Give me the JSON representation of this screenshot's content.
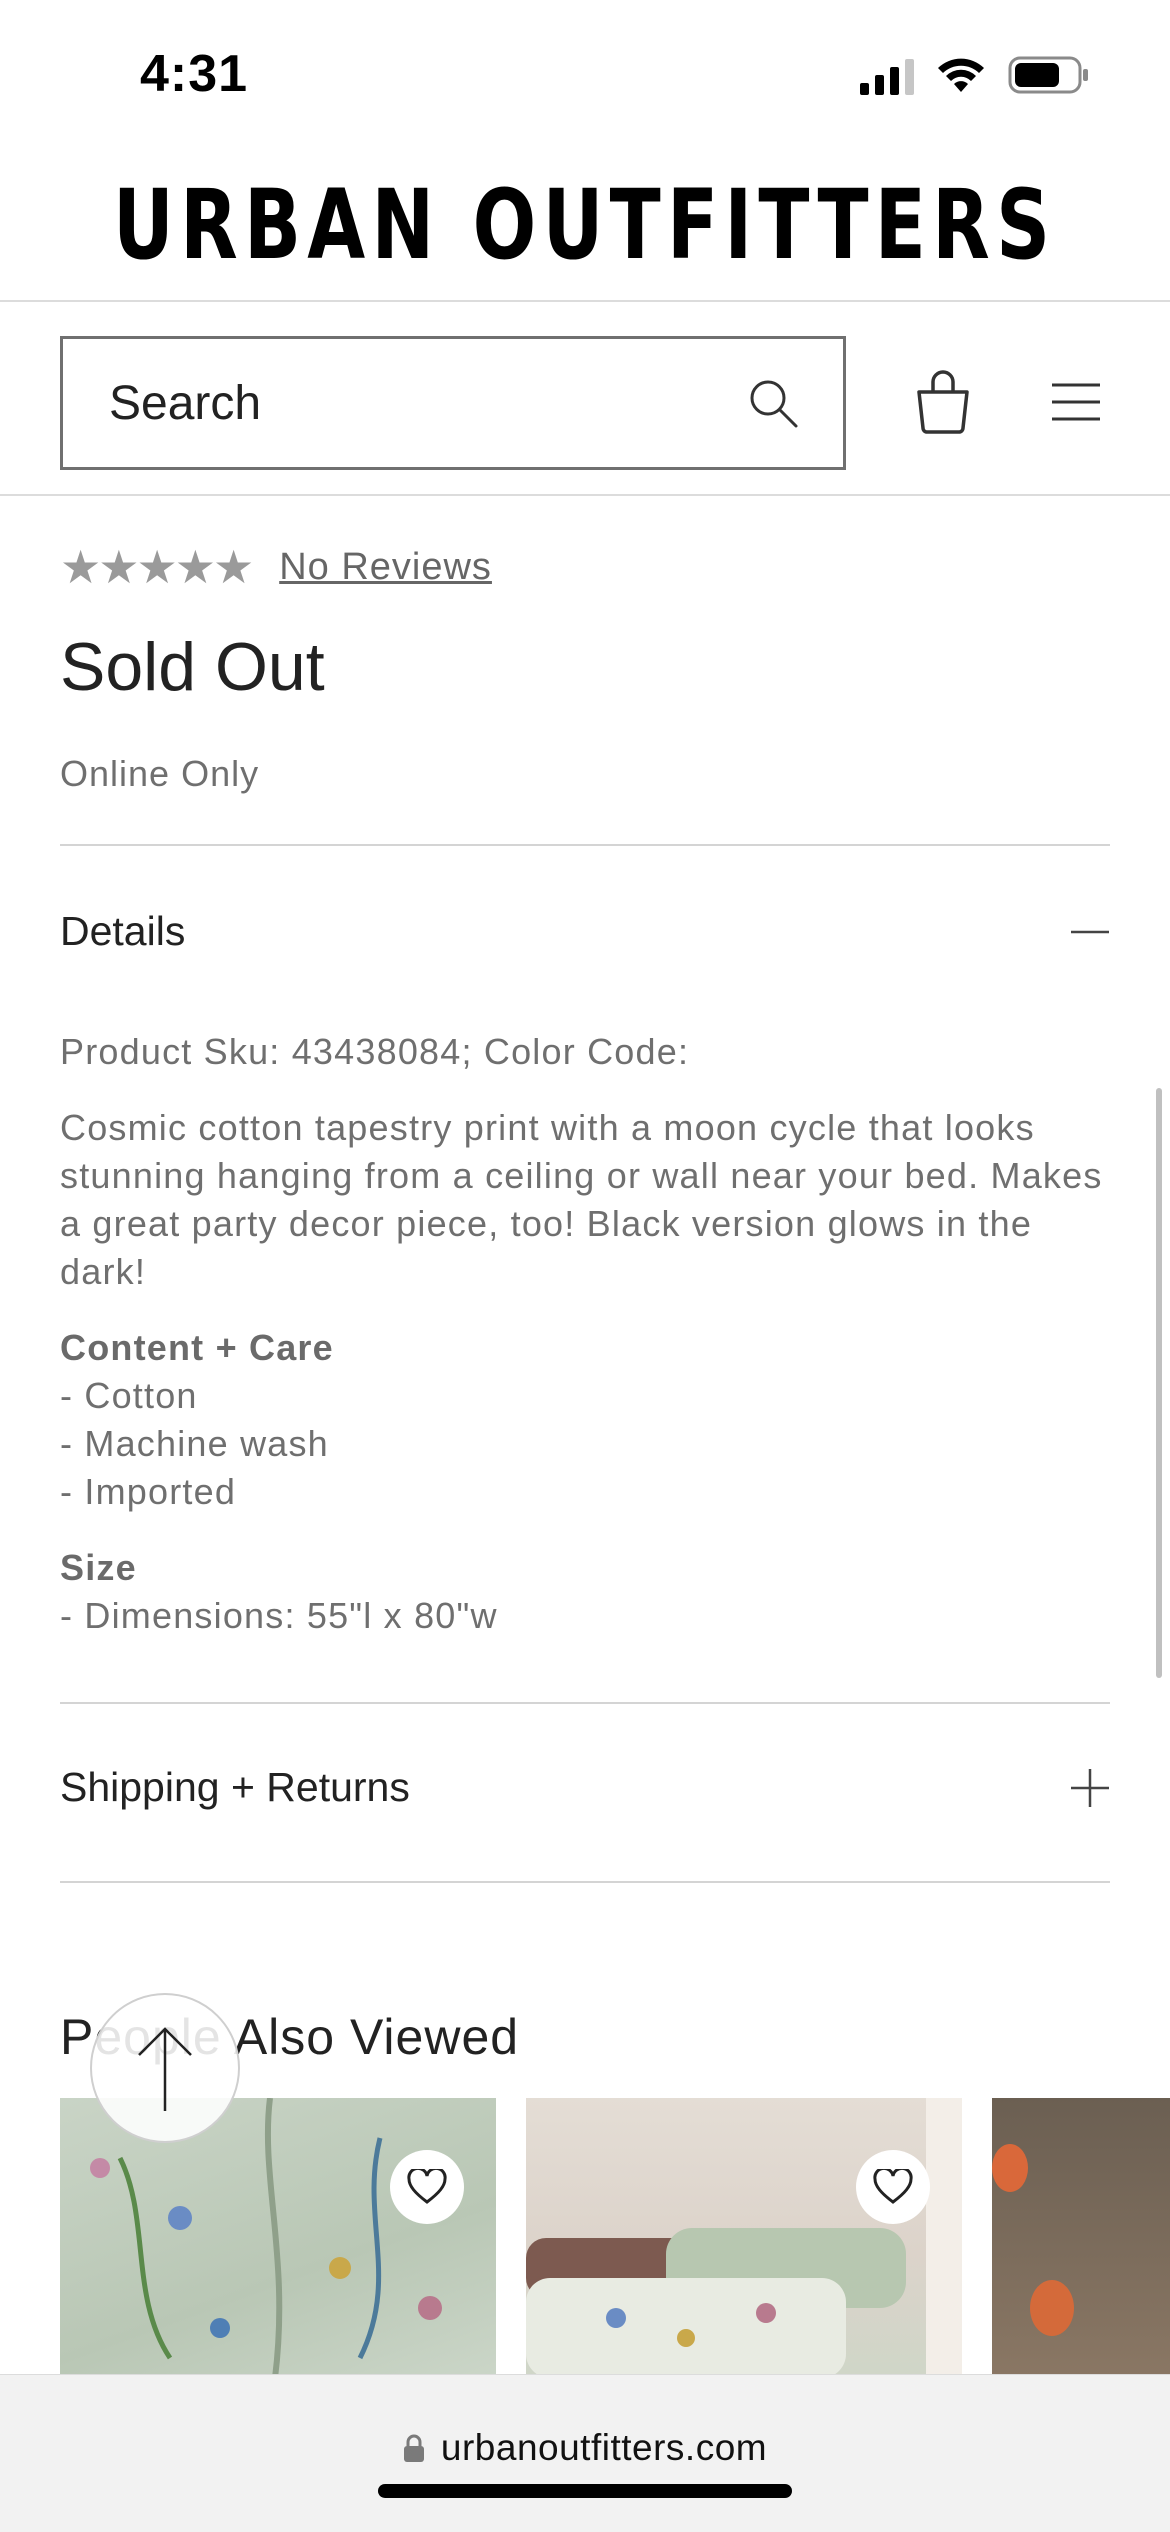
{
  "status_bar": {
    "time": "4:31",
    "signal_icon": "cellular-signal-icon",
    "wifi_icon": "wifi-icon",
    "battery_icon": "battery-icon"
  },
  "brand": {
    "logo_text": "URBAN OUTFITTERS"
  },
  "search": {
    "placeholder": "Search",
    "icon": "search-icon"
  },
  "header_actions": {
    "bag_icon": "shopping-bag-icon",
    "menu_icon": "hamburger-menu-icon"
  },
  "product": {
    "stars": "★★★★★",
    "reviews_link": "No Reviews",
    "price": "Sold Out",
    "availability": "Online Only"
  },
  "details": {
    "title": "Details",
    "sku_line": "Product Sku: 43438084; Color Code:",
    "description": "Cosmic cotton tapestry print with a moon cycle that looks stunning hanging from a ceiling or wall near your bed. Makes a great party decor piece, too! Black version glows in the dark!",
    "content_care_label": "Content + Care",
    "content_care_items": [
      "- Cotton",
      "- Machine wash",
      "- Imported"
    ],
    "size_label": "Size",
    "size_items": [
      "- Dimensions: 55\"l x 80\"w"
    ]
  },
  "shipping": {
    "title": "Shipping + Returns"
  },
  "people_also_viewed": {
    "title": "People Also Viewed"
  },
  "browser": {
    "url": "urbanoutfitters.com"
  },
  "colors": {
    "accent_text": "#222222",
    "muted_text": "#6f6f6f",
    "divider": "#d4d4d4"
  }
}
